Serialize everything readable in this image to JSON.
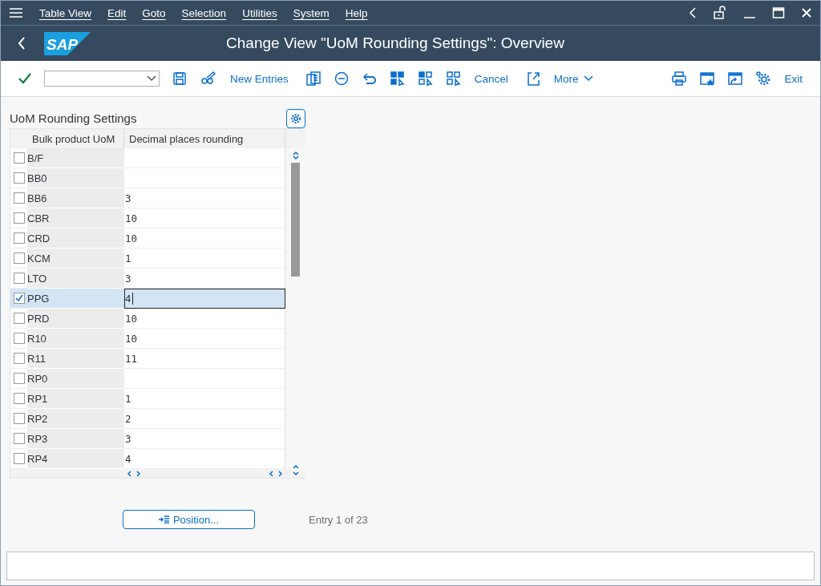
{
  "menu": [
    "Table View",
    "Edit",
    "Goto",
    "Selection",
    "Utilities",
    "System",
    "Help"
  ],
  "logo": "SAP",
  "title": "Change View \"UoM Rounding Settings\": Overview",
  "toolbar": {
    "new_entries": "New Entries",
    "cancel": "Cancel",
    "more": "More",
    "exit": "Exit"
  },
  "table": {
    "title": "UoM Rounding Settings",
    "columns": [
      "Bulk product UoM",
      "Decimal places rounding"
    ],
    "rows": [
      {
        "uom": "B/F",
        "selected": false
      },
      {
        "uom": "BB0",
        "selected": false
      },
      {
        "uom": "BB6",
        "decimals": "3",
        "selected": false
      },
      {
        "uom": "CBR",
        "decimals": "10",
        "selected": false
      },
      {
        "uom": "CRD",
        "decimals": "10",
        "selected": false
      },
      {
        "uom": "KCM",
        "decimals": "1",
        "selected": false
      },
      {
        "uom": "LTO",
        "decimals": "3",
        "selected": false
      },
      {
        "uom": "PPG",
        "decimals": "4",
        "selected": true
      },
      {
        "uom": "PRD",
        "decimals": "10",
        "selected": false
      },
      {
        "uom": "R10",
        "decimals": "10",
        "selected": false
      },
      {
        "uom": "R11",
        "decimals": "11",
        "selected": false
      },
      {
        "uom": "RP0",
        "selected": false
      },
      {
        "uom": "RP1",
        "decimals": "1",
        "selected": false
      },
      {
        "uom": "RP2",
        "decimals": "2",
        "selected": false
      },
      {
        "uom": "RP3",
        "decimals": "3",
        "selected": false
      },
      {
        "uom": "RP4",
        "decimals": "4",
        "selected": false
      }
    ]
  },
  "footer": {
    "position_button": "Position...",
    "entry_info": "Entry 1 of 23"
  }
}
